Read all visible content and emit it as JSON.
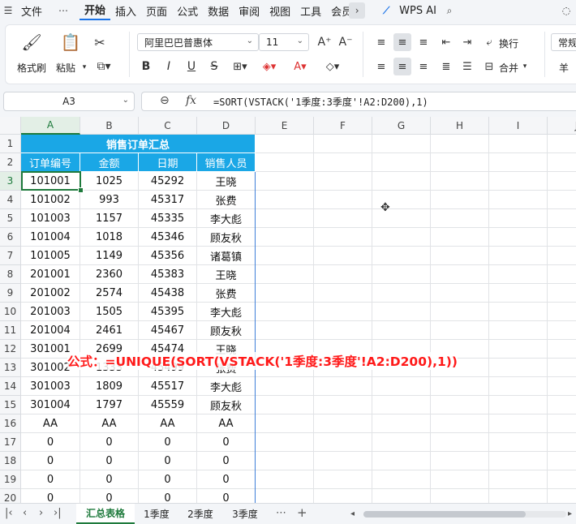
{
  "menu": {
    "items": [
      "文件",
      "开始",
      "插入",
      "页面",
      "公式",
      "数据",
      "审阅",
      "视图",
      "工具",
      "会员"
    ],
    "active": "开始",
    "wps_ai": "WPS AI"
  },
  "ribbon": {
    "format_painter": "格式刷",
    "paste": "粘贴",
    "font_name": "阿里巴巴普惠体",
    "font_size": "11",
    "wrap": "换行",
    "merge": "合并",
    "number_format": "常规",
    "currency": "羊"
  },
  "formula_bar": {
    "name_box": "A3",
    "fx": "fx",
    "formula": "=SORT(VSTACK('1季度:3季度'!A2:D200),1)"
  },
  "columns": [
    "A",
    "B",
    "C",
    "D",
    "E",
    "F",
    "G",
    "H",
    "I",
    "J"
  ],
  "rows": [
    "1",
    "2",
    "3",
    "4",
    "5",
    "6",
    "7",
    "8",
    "9",
    "10",
    "11",
    "12",
    "13",
    "14",
    "15",
    "16",
    "17",
    "18",
    "19",
    "20"
  ],
  "table": {
    "title": "销售订单汇总",
    "headers": [
      "订单编号",
      "金额",
      "日期",
      "销售人员"
    ],
    "data": [
      [
        "101001",
        "1025",
        "45292",
        "王晓"
      ],
      [
        "101002",
        "993",
        "45317",
        "张费"
      ],
      [
        "101003",
        "1157",
        "45335",
        "李大彪"
      ],
      [
        "101004",
        "1018",
        "45346",
        "顾友秋"
      ],
      [
        "101005",
        "1149",
        "45356",
        "诸葛镇"
      ],
      [
        "201001",
        "2360",
        "45383",
        "王晓"
      ],
      [
        "201002",
        "2574",
        "45438",
        "张费"
      ],
      [
        "201003",
        "1505",
        "45395",
        "李大彪"
      ],
      [
        "201004",
        "2461",
        "45467",
        "顾友秋"
      ],
      [
        "301001",
        "2699",
        "45474",
        "王晓"
      ],
      [
        "301002",
        "1333",
        "45499",
        "张费"
      ],
      [
        "301003",
        "1809",
        "45517",
        "李大彪"
      ],
      [
        "301004",
        "1797",
        "45559",
        "顾友秋"
      ],
      [
        "AA",
        "AA",
        "AA",
        "AA"
      ],
      [
        "0",
        "0",
        "0",
        "0"
      ],
      [
        "0",
        "0",
        "0",
        "0"
      ],
      [
        "0",
        "0",
        "0",
        "0"
      ],
      [
        "0",
        "0",
        "0",
        "0"
      ]
    ]
  },
  "overlay_text": "公式：=UNIQUE(SORT(VSTACK('1季度:3季度'!A2:D200),1))",
  "sheets": [
    "汇总表格",
    "1季度",
    "2季度",
    "3季度"
  ],
  "active_sheet": "汇总表格",
  "colors": {
    "header_blue": "#1aa7e6",
    "accent_green": "#1e7a3c",
    "overlay_red": "#ff1a1a"
  }
}
